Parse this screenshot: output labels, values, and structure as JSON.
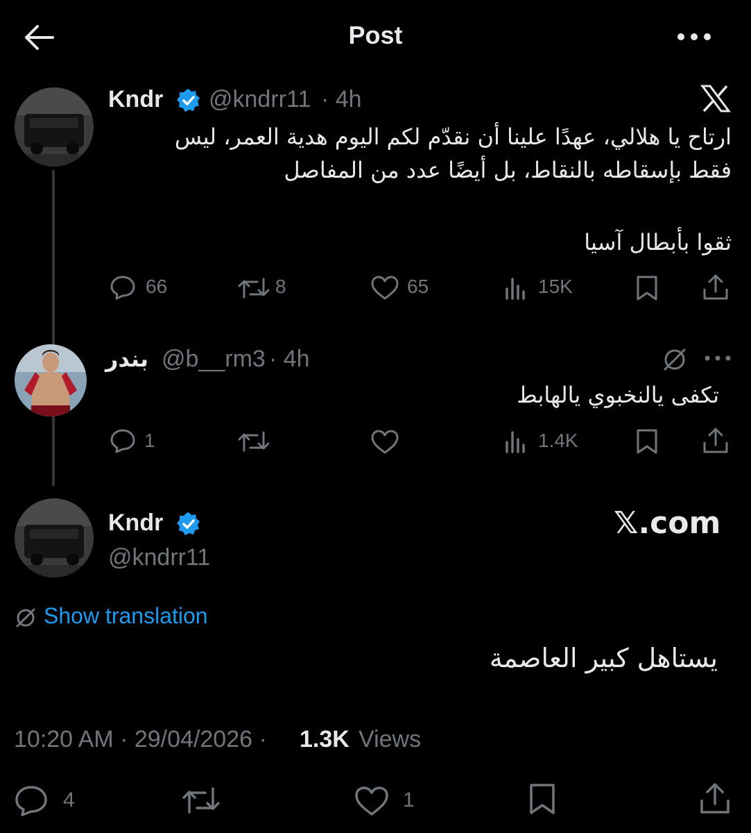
{
  "header": {
    "title": "Post",
    "back_icon": "arrow-left-icon",
    "more_icon": "ellipsis-icon"
  },
  "quoted_post": {
    "name": "Kndr",
    "handle": "@kndrr11",
    "time": "· 4h",
    "text_line1": "ارتاح يا هلالي، عهدًا علينا أن نقدّم لكم اليوم هدية العمر، ليس",
    "text_line2": "فقط بإسقاطه بالنقاط، بل أيضًا عدد من المفاصل",
    "text_line3": "ثقوا بأبطال آسيا",
    "replies": "66",
    "reposts": "8",
    "likes": "65",
    "views": "15K"
  },
  "reply_post": {
    "name": "بندر",
    "handle": "@b__rm3",
    "time": "· 4h",
    "text": "تكفى يالنخبوي يالهابط",
    "replies": "1",
    "views": "1.4K"
  },
  "main_post": {
    "name": "Kndr",
    "handle": "@kndrr11",
    "brand": "𝕏.com",
    "show_translation": "Show translation",
    "text": "يستاهل كبير العاصمة",
    "timestamp": "10:20 AM · 29/04/2026 ·",
    "views_count": "1.3K",
    "views_label": "Views"
  },
  "action_bar": {
    "replies": "4",
    "likes": "1"
  },
  "colors": {
    "background": "#000000",
    "text": "#e7e9ea",
    "muted": "#71767b",
    "verified": "#1d9bf0",
    "link": "#1d9bf0"
  }
}
